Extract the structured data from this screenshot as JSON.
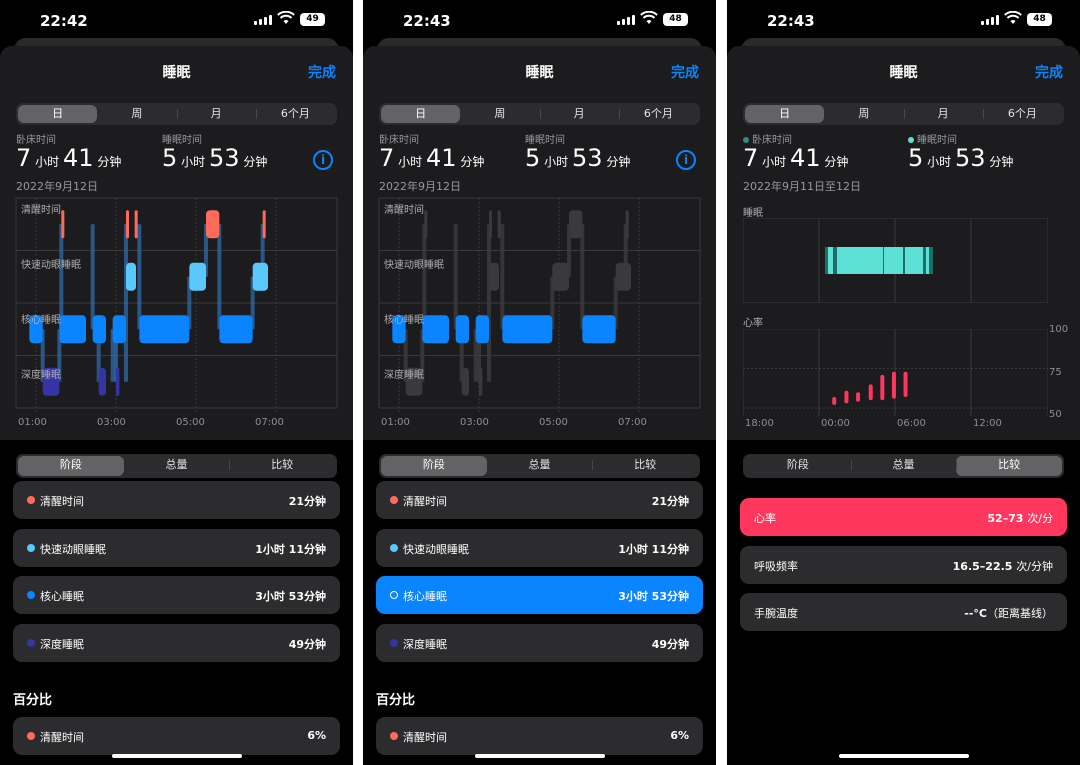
{
  "status": [
    {
      "time": "22:42",
      "battery": "49"
    },
    {
      "time": "22:43",
      "battery": "48"
    },
    {
      "time": "22:43",
      "battery": "48"
    }
  ],
  "header": {
    "title": "睡眠",
    "done": "完成"
  },
  "range_tabs": [
    "日",
    "周",
    "月",
    "6个月"
  ],
  "panels": [
    {
      "in_bed_label": "卧床时间",
      "in_bed_h": "7",
      "in_bed_m": "41",
      "asleep_label": "睡眠时间",
      "asleep_h": "5",
      "asleep_m": "53",
      "hour_unit": "小时",
      "min_unit": "分钟",
      "date": "2022年9月12日"
    },
    {
      "in_bed_label": "卧床时间",
      "in_bed_h": "7",
      "in_bed_m": "41",
      "asleep_label": "睡眠时间",
      "asleep_h": "5",
      "asleep_m": "53",
      "hour_unit": "小时",
      "min_unit": "分钟",
      "date": "2022年9月12日"
    },
    {
      "in_bed_label": "卧床时间",
      "in_bed_h": "7",
      "in_bed_m": "41",
      "asleep_label": "睡眠时间",
      "asleep_h": "5",
      "asleep_m": "53",
      "hour_unit": "小时",
      "min_unit": "分钟",
      "date": "2022年9月11日至12日",
      "sleep_label": "睡眠",
      "hr_label": "心率"
    }
  ],
  "stage_labels": [
    "清醒时间",
    "快速动眼睡眠",
    "核心睡眠",
    "深度睡眠"
  ],
  "stage_axis": [
    "01:00",
    "03:00",
    "05:00",
    "07:00"
  ],
  "third_axis": [
    "18:00",
    "00:00",
    "06:00",
    "12:00"
  ],
  "hr_ticks": [
    "100",
    "75",
    "50"
  ],
  "hr_bars": [
    {
      "t": "01:12",
      "low": 52,
      "high": 57
    },
    {
      "t": "02:10",
      "low": 53,
      "high": 61
    },
    {
      "t": "03:05",
      "low": 54,
      "high": 60
    },
    {
      "t": "04:05",
      "low": 55,
      "high": 65
    },
    {
      "t": "05:00",
      "low": 55,
      "high": 71
    },
    {
      "t": "05:55",
      "low": 56,
      "high": 73
    },
    {
      "t": "06:50",
      "low": 57,
      "high": 73
    }
  ],
  "hypnogram": {
    "stages": [
      "awake",
      "rem",
      "core",
      "deep"
    ],
    "segments": [
      {
        "stage": "core",
        "start": "00:50",
        "end": "01:10"
      },
      {
        "stage": "deep",
        "start": "01:10",
        "end": "01:35"
      },
      {
        "stage": "core",
        "start": "01:35",
        "end": "02:15"
      },
      {
        "stage": "awake",
        "start": "01:38",
        "end": "01:41"
      },
      {
        "stage": "core",
        "start": "02:25",
        "end": "02:45"
      },
      {
        "stage": "deep",
        "start": "02:34",
        "end": "02:45"
      },
      {
        "stage": "core",
        "start": "02:55",
        "end": "03:15"
      },
      {
        "stage": "deep",
        "start": "03:00",
        "end": "03:05"
      },
      {
        "stage": "rem",
        "start": "03:15",
        "end": "03:30"
      },
      {
        "stage": "awake",
        "start": "03:15",
        "end": "03:19"
      },
      {
        "stage": "awake",
        "start": "03:28",
        "end": "03:31"
      },
      {
        "stage": "core",
        "start": "03:35",
        "end": "04:50"
      },
      {
        "stage": "rem",
        "start": "04:50",
        "end": "05:15"
      },
      {
        "stage": "awake",
        "start": "05:15",
        "end": "05:35"
      },
      {
        "stage": "core",
        "start": "05:35",
        "end": "06:25"
      },
      {
        "stage": "rem",
        "start": "06:25",
        "end": "06:48"
      },
      {
        "stage": "awake",
        "start": "06:40",
        "end": "06:44"
      }
    ]
  },
  "summary_tabs": [
    "阶段",
    "总量",
    "比较"
  ],
  "summary_active": [
    0,
    0,
    2
  ],
  "stage_rows": [
    {
      "name": "清醒时间",
      "value": "21分钟",
      "color": "#ff6b5a"
    },
    {
      "name": "快速动眼睡眠",
      "value": "1小时 11分钟",
      "color": "#5ac8fa"
    },
    {
      "name": "核心睡眠",
      "value": "3小时 53分钟",
      "color": "#0a84ff"
    },
    {
      "name": "深度睡眠",
      "value": "49分钟",
      "color": "#3634a3"
    }
  ],
  "percent_title": "百分比",
  "percent_row": {
    "name": "清醒时间",
    "value": "6%"
  },
  "compare_rows": [
    {
      "name": "心率",
      "value": "52–73",
      "unit": "次/分"
    },
    {
      "name": "呼吸频率",
      "value": "16.5–22.5",
      "unit": "次/分钟"
    },
    {
      "name": "手腕温度",
      "value": "--°C",
      "unit": "（距离基线）"
    }
  ],
  "colors": {
    "awake": "#ff6b5a",
    "rem": "#5ac8fa",
    "core": "#0a84ff",
    "deep": "#3634a3",
    "accent": "#0a84ff",
    "heart": "#ff375f",
    "teal": "#5de0d6"
  }
}
